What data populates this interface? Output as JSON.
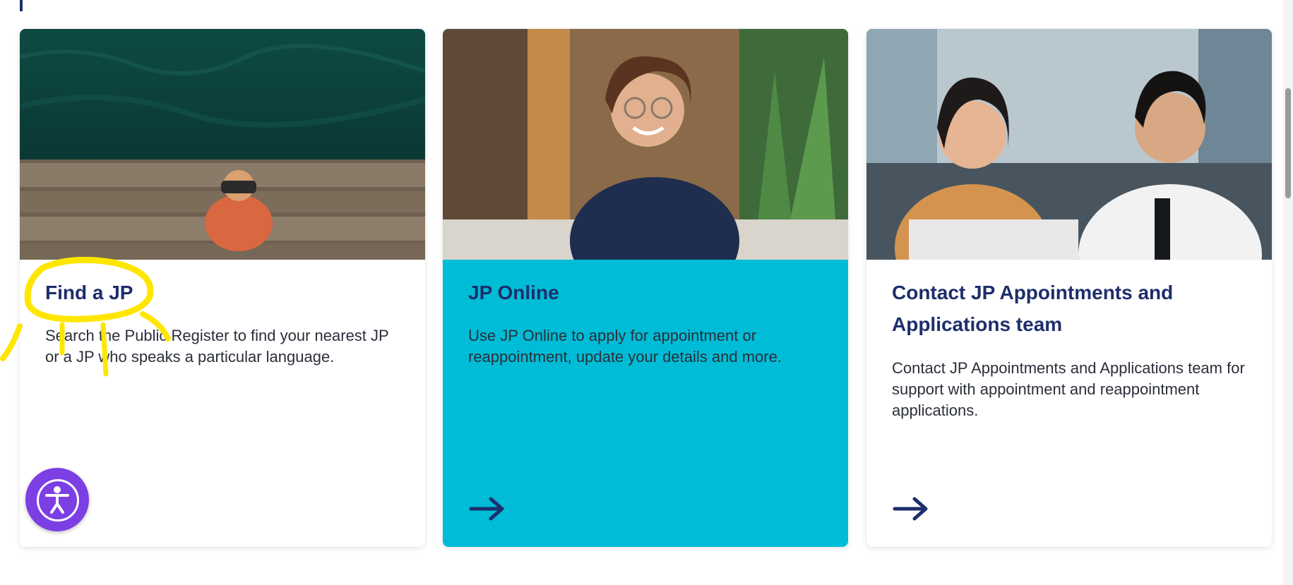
{
  "cards": [
    {
      "title": "Find a JP",
      "description": "Search the Public Register to find your nearest JP or a JP who speaks a particular language.",
      "image_alt": "person-with-binoculars-photo"
    },
    {
      "title": "JP Online",
      "description": "Use JP Online to apply for appointment or reappointment, update your details and more.",
      "image_alt": "smiling-woman-photo"
    },
    {
      "title": "Contact JP Appointments and Applications team",
      "description": "Contact JP Appointments and Applications team for support with appointment and reappointment applications.",
      "image_alt": "call-centre-team-photo"
    }
  ],
  "icons": {
    "arrow": "arrow-right-icon",
    "accessibility": "accessibility-icon"
  },
  "colors": {
    "brand_navy": "#1d2e6b",
    "card_highlight": "#00bcd6",
    "accessibility_purple": "#7b3fe4",
    "annotation_yellow": "#ffe600"
  }
}
